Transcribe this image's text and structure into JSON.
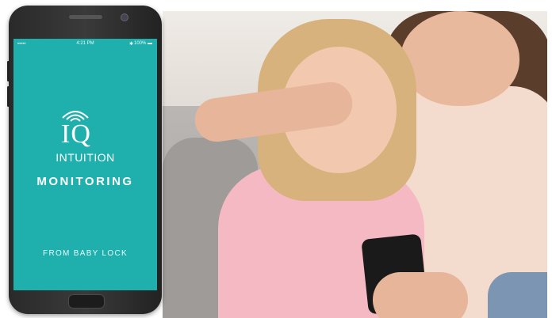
{
  "app": {
    "brand_initials": "IQ",
    "brand_name": "INTUITION",
    "product": "MONITORING",
    "tagline": "FROM BABY LOCK"
  },
  "status_bar": {
    "signal": "•••••",
    "time": "4:21 PM",
    "bluetooth": "✱",
    "battery": "100% ▬"
  },
  "colors": {
    "screen_bg": "#1fb0ae",
    "text": "#ffffff"
  },
  "icons": {
    "signal": "signal-icon",
    "wifi_waves": "wireless-waves-icon",
    "battery": "battery-icon"
  }
}
